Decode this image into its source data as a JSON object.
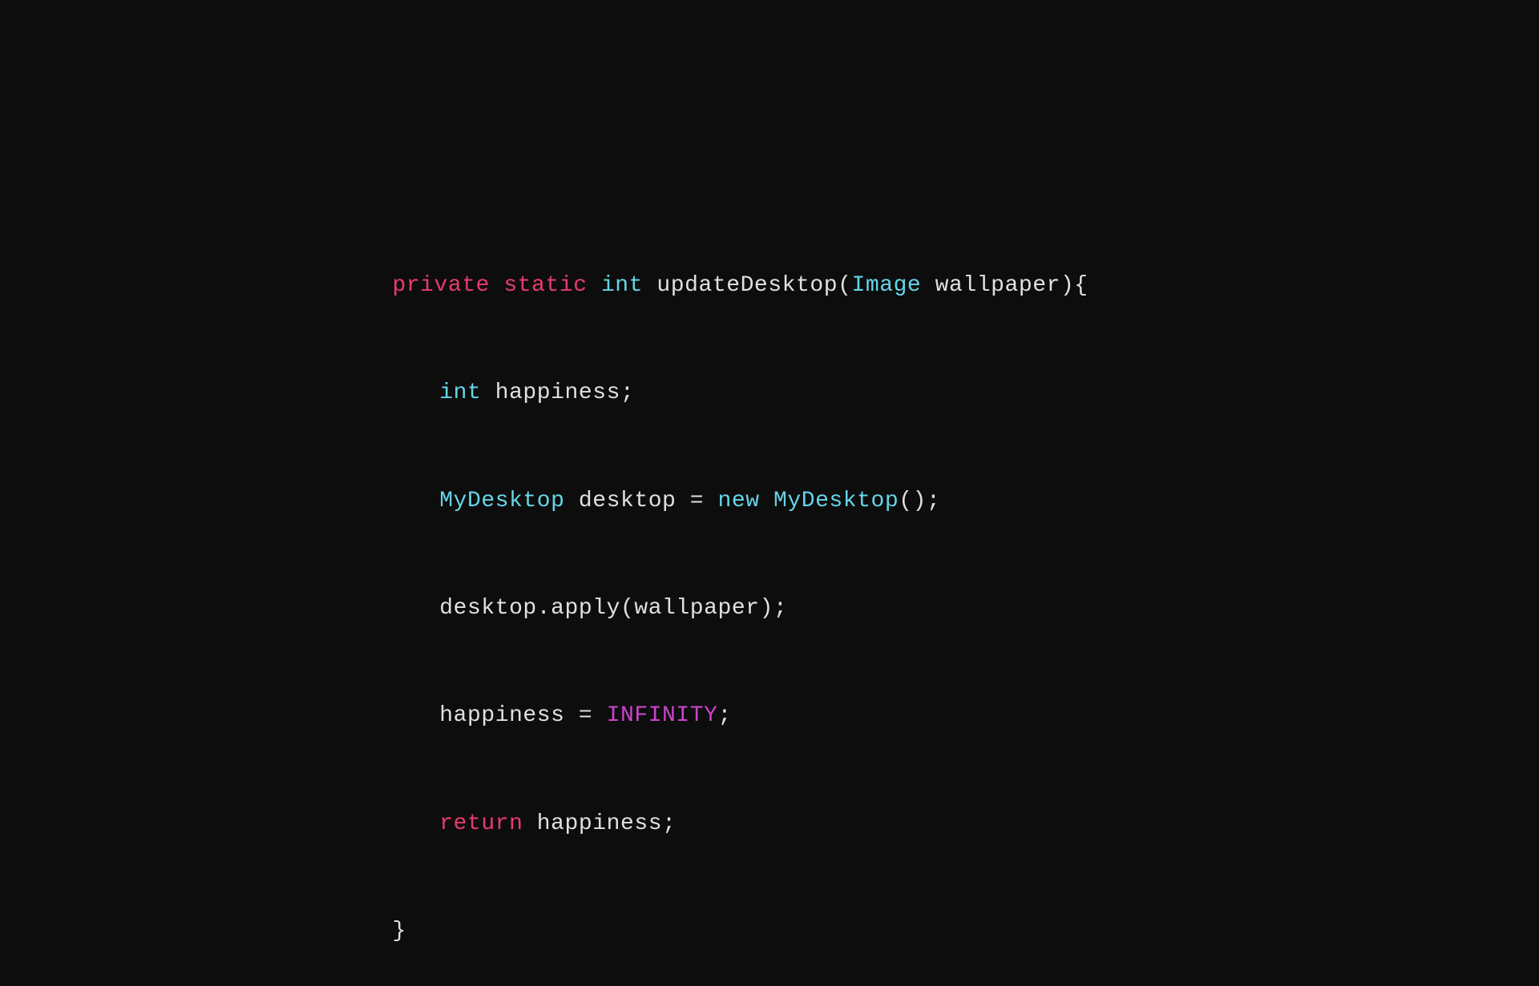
{
  "background": "#0d0d0d",
  "code": {
    "line1": {
      "parts": [
        {
          "text": "private",
          "class": "keyword-private"
        },
        {
          "text": " ",
          "class": "plain"
        },
        {
          "text": "static",
          "class": "keyword-static"
        },
        {
          "text": " ",
          "class": "plain"
        },
        {
          "text": "int",
          "class": "keyword-int"
        },
        {
          "text": " updateDesktop(",
          "class": "plain"
        },
        {
          "text": "Image",
          "class": "class-name"
        },
        {
          "text": " wallpaper){",
          "class": "plain"
        }
      ]
    },
    "line2": {
      "indent": true,
      "parts": [
        {
          "text": "int",
          "class": "keyword-int"
        },
        {
          "text": " happiness;",
          "class": "plain"
        }
      ]
    },
    "line3": {
      "indent": true,
      "parts": [
        {
          "text": "MyDesktop",
          "class": "class-name"
        },
        {
          "text": " desktop = ",
          "class": "plain"
        },
        {
          "text": "new",
          "class": "keyword-new"
        },
        {
          "text": " ",
          "class": "plain"
        },
        {
          "text": "MyDesktop",
          "class": "class-name"
        },
        {
          "text": "();",
          "class": "plain"
        }
      ]
    },
    "line4": {
      "indent": true,
      "parts": [
        {
          "text": "desktop.apply(wallpaper);",
          "class": "plain"
        }
      ]
    },
    "line5": {
      "indent": true,
      "parts": [
        {
          "text": "happiness = ",
          "class": "plain"
        },
        {
          "text": "INFINITY",
          "class": "constant"
        },
        {
          "text": ";",
          "class": "plain"
        }
      ]
    },
    "line6": {
      "indent": true,
      "parts": [
        {
          "text": "return",
          "class": "keyword-return"
        },
        {
          "text": " happiness;",
          "class": "plain"
        }
      ]
    },
    "line7": {
      "indent": false,
      "parts": [
        {
          "text": "}",
          "class": "brace"
        }
      ]
    }
  }
}
